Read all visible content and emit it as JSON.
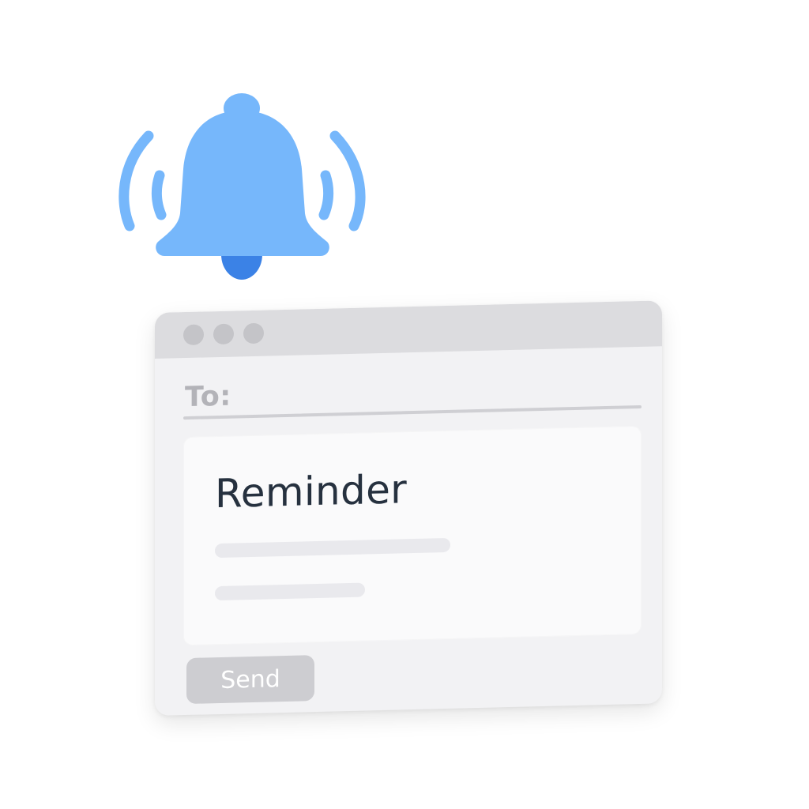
{
  "icons": {
    "bell": "bell-icon",
    "bell_color": "#76b7fb",
    "clapper_color": "#3b82e6"
  },
  "window": {
    "control_dots": [
      "window-dot",
      "window-dot",
      "window-dot"
    ],
    "to_label": "To:",
    "subject": "Reminder",
    "send_label": "Send"
  },
  "colors": {
    "titlebar": "#dcdcdf",
    "window_bg": "#f2f2f4",
    "subject_text": "#26313f",
    "button_bg": "#cdcdd1"
  }
}
